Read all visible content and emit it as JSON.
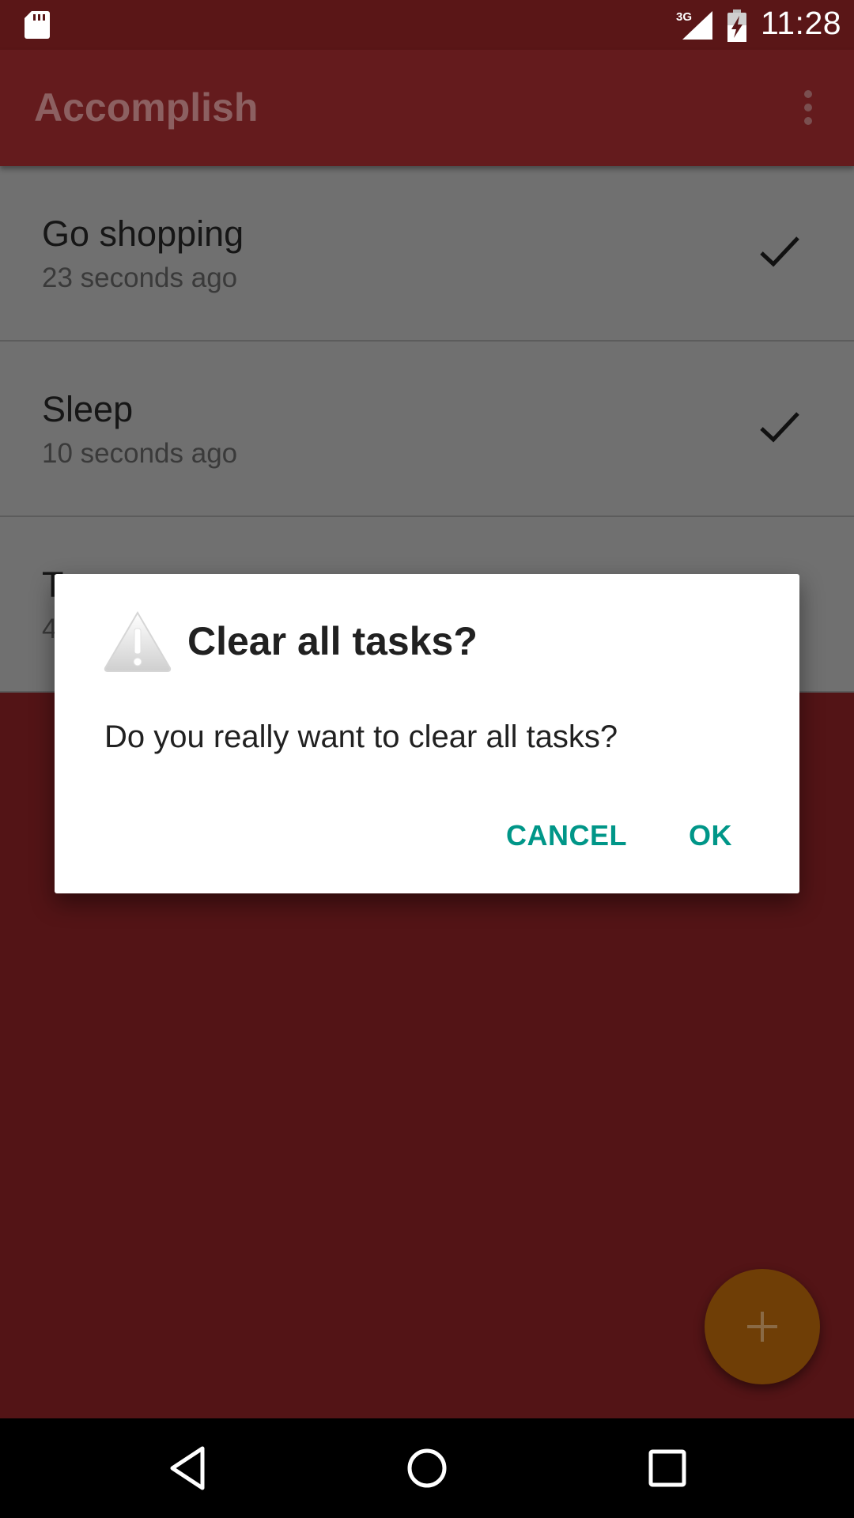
{
  "status_bar": {
    "time": "11:28",
    "network": "3G",
    "icons": [
      "sd-card-icon",
      "signal-icon",
      "battery-icon"
    ]
  },
  "app_bar": {
    "title": "Accomplish",
    "menu_icon": "overflow-menu-icon"
  },
  "tasks": [
    {
      "title": "Go shopping",
      "time": "23 seconds ago",
      "icon": "check-icon"
    },
    {
      "title": "Sleep",
      "time": "10 seconds ago",
      "icon": "check-icon"
    },
    {
      "title": "T",
      "time": "4",
      "icon": "check-icon"
    }
  ],
  "dialog": {
    "icon": "warning-icon",
    "title": "Clear all tasks?",
    "message": "Do you really want to clear all tasks?",
    "cancel_label": "CANCEL",
    "ok_label": "OK"
  },
  "fab": {
    "icon": "plus-icon"
  },
  "nav_bar": {
    "icons": [
      "back-icon",
      "home-icon",
      "recents-icon"
    ]
  },
  "colors": {
    "app_bar": "#641b1d",
    "background": "#531416",
    "accent_button": "#009688",
    "fab": "#6f3e06"
  }
}
